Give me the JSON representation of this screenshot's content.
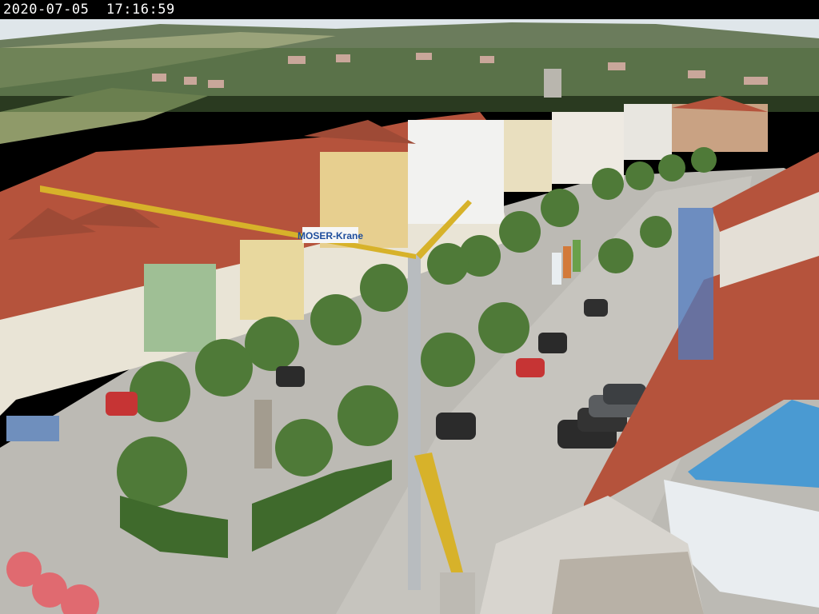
{
  "overlay": {
    "timestamp": "2020-07-05  17:16:59"
  },
  "crane": {
    "banner_text": "MOSER-Krane"
  },
  "colors": {
    "sky": "#dfe6ea",
    "roof": "#b5533c",
    "street": "#bcbab4",
    "tree": "#4f7a38",
    "crane_yellow": "#d7b22a"
  }
}
